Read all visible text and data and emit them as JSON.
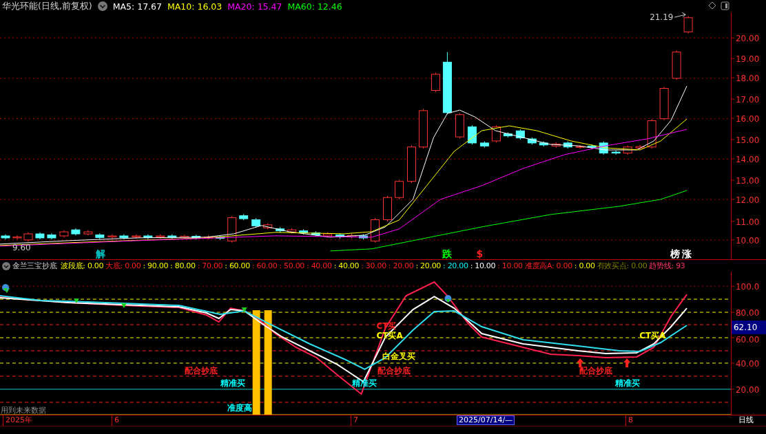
{
  "header": {
    "title": "华光环能(日线,前复权)",
    "averages": [
      {
        "label": "MA5: 17.67",
        "color": "#ffffff"
      },
      {
        "label": "MA10: 16.03",
        "color": "#ffff00"
      },
      {
        "label": "MA20: 15.47",
        "color": "#ff00ff"
      },
      {
        "label": "MA60: 12.46",
        "color": "#00ff00"
      }
    ]
  },
  "price_chart": {
    "axis_labels": [
      "20.00",
      "19.00",
      "18.00",
      "17.00",
      "16.00",
      "15.00",
      "14.00",
      "13.00",
      "12.00",
      "11.00",
      "10.00"
    ],
    "high_label": "21.19",
    "low_label": "9.60",
    "markers": [
      {
        "text": "解",
        "color": "#00c8c8"
      },
      {
        "text": "跌",
        "color": "#00ff00"
      },
      {
        "text": "$",
        "color": "#ff2020"
      },
      {
        "text": "榜",
        "color": "#ffffff"
      },
      {
        "text": "涨",
        "color": "#ffffff"
      }
    ]
  },
  "indicator": {
    "title": "金兰三宝抄底",
    "values": [
      {
        "text": "波段底: 0.00",
        "color": "#ffff00"
      },
      {
        "text": "大底: 0.00",
        "color": "#ff2020"
      },
      {
        "text": ": 90.00",
        "color": "#ffff00"
      },
      {
        "text": ": 80.00",
        "color": "#ffff00"
      },
      {
        "text": ": 70.00",
        "color": "#ff2020"
      },
      {
        "text": ": 60.00",
        "color": "#ffff00"
      },
      {
        "text": ": 60.00",
        "color": "#ff2020"
      },
      {
        "text": ": 50.00",
        "color": "#ff2020"
      },
      {
        "text": ": 40.00",
        "color": "#ff2020"
      },
      {
        "text": ": 40.00",
        "color": "#ffff00"
      },
      {
        "text": ": 30.00",
        "color": "#ff2020"
      },
      {
        "text": ": 20.00",
        "color": "#ff2020"
      },
      {
        "text": ": 20.00",
        "color": "#ffff00"
      },
      {
        "text": ": 20.00",
        "color": "#00ffff"
      },
      {
        "text": ": 10.00",
        "color": "#ffffff"
      },
      {
        "text": ": 10.00",
        "color": "#ff2020"
      },
      {
        "text": "准度高A: 0.00",
        "color": "#ff2020"
      },
      {
        "text": ": 0.00",
        "color": "#ffff00"
      },
      {
        "text": "有效买点: 0.00",
        "color": "#808000"
      },
      {
        "text": "趋势线: 93",
        "color": "#ff3366"
      }
    ],
    "axis_labels": [
      "100.0",
      "80.00",
      "60.00",
      "40.00",
      "20.00"
    ],
    "current_value": "62.10",
    "signals": [
      {
        "text": "配合抄底",
        "color": "#ff2020"
      },
      {
        "text": "精准买",
        "color": "#00ffff"
      },
      {
        "text": "准度高",
        "color": "#00ffff"
      },
      {
        "text": "CT买",
        "color": "#ff2020"
      },
      {
        "text": "CT买A",
        "color": "#ffff00"
      },
      {
        "text": "白金叉买",
        "color": "#ffff00"
      },
      {
        "text": "配合抄底",
        "color": "#ff2020"
      },
      {
        "text": "精准买",
        "color": "#00ffff"
      },
      {
        "text": "配合抄底",
        "color": "#ff2020"
      },
      {
        "text": "精准买",
        "color": "#00ffff"
      },
      {
        "text": "CT买A",
        "color": "#ffff00"
      }
    ],
    "notice": "用到未来数据"
  },
  "date_axis": {
    "labels": [
      "2025年",
      "6",
      "7",
      "8"
    ],
    "cursor_date": "2025/07/14/—",
    "period": "日线"
  }
}
